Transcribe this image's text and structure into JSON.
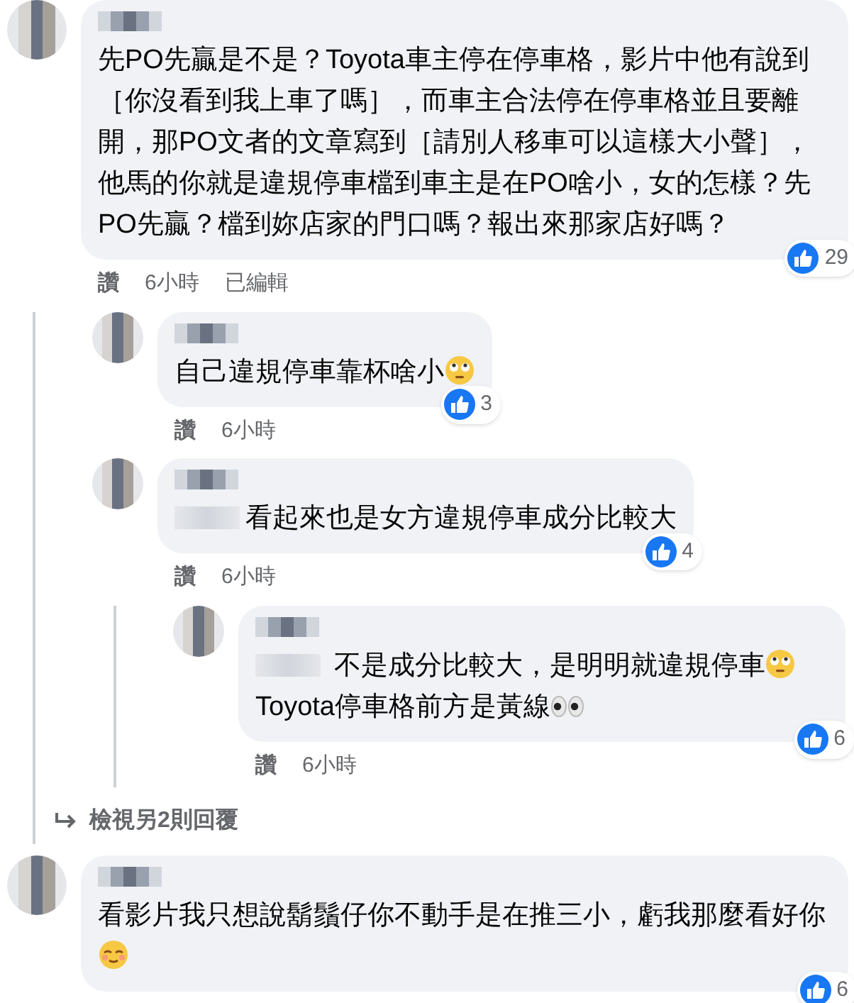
{
  "comments": [
    {
      "body": [
        {
          "kind": "text",
          "text": "先PO先贏是不是？Toyota車主停在停車格，影片中他有說到［你沒看到我上車了嗎］，而車主合法停在停車格並且要離開，那PO文者的文章寫到［請別人移車可以這樣大小聲］，他馬的你就是違規停車檔到車主是在PO啥小，女的怎樣？先PO先贏？檔到妳店家的門口嗎？報出來那家店好嗎？"
        }
      ],
      "reactions": "29",
      "actions": {
        "like": "讚",
        "time": "6小時",
        "edited": "已編輯"
      },
      "replies": [
        {
          "kind": "comment",
          "body": [
            {
              "kind": "text",
              "text": "自己違規停車靠杯啥小"
            },
            {
              "kind": "rolling_eyes_emoji"
            }
          ],
          "reactions": "3",
          "actions": {
            "like": "讚",
            "time": "6小時"
          }
        },
        {
          "kind": "comment",
          "body": [
            {
              "kind": "mention"
            },
            {
              "kind": "text",
              "text": "看起來也是女方違規停車成分比較大"
            }
          ],
          "reactions": "4",
          "actions": {
            "like": "讚",
            "time": "6小時"
          },
          "replies": [
            {
              "kind": "comment",
              "body": [
                {
                  "kind": "mention"
                },
                {
                  "kind": "text",
                  "text": " 不是成分比較大，是明明就違規停車"
                },
                {
                  "kind": "rolling_eyes_emoji"
                },
                {
                  "kind": "text",
                  "text": "Toyota停車格前方是黃線"
                },
                {
                  "kind": "eyes_emoji"
                }
              ],
              "reactions": "6",
              "actions": {
                "like": "讚",
                "time": "6小時"
              }
            }
          ]
        },
        {
          "kind": "more_replies",
          "text": "檢視另2則回覆"
        }
      ]
    },
    {
      "body": [
        {
          "kind": "text",
          "text": "看影片我只想說鬍鬚仔你不動手是在推三小，虧我那麼看好你"
        },
        {
          "kind": "relieved_emoji"
        }
      ],
      "reactions": "6"
    }
  ]
}
